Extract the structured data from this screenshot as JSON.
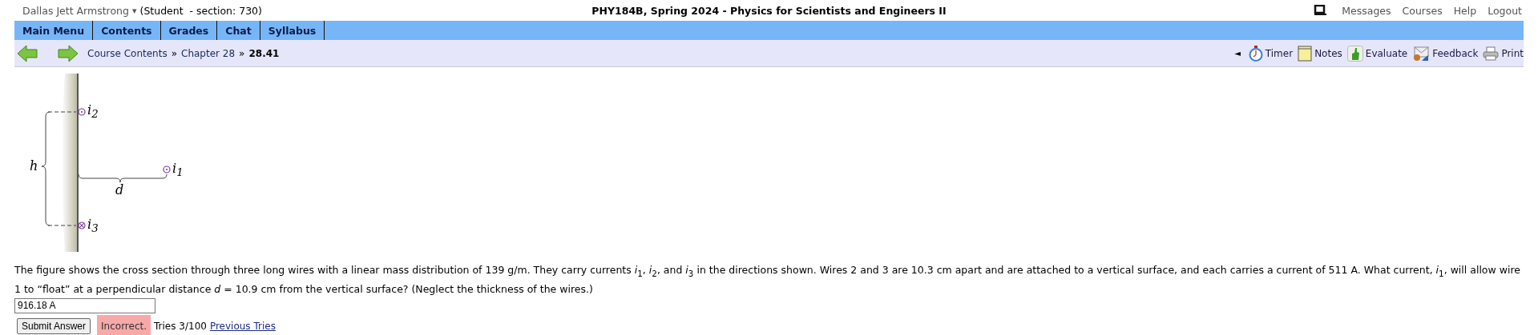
{
  "header": {
    "user_name": "Dallas Jett Armstrong",
    "user_caret": "▾",
    "role": "(Student  - section: 730)",
    "course_title": "PHY184B, Spring 2024 - Physics for Scientists and Engineers II",
    "links": [
      "Messages",
      "Courses",
      "Help",
      "Logout"
    ]
  },
  "menu": [
    "Main Menu",
    "Contents",
    "Grades",
    "Chat",
    "Syllabus"
  ],
  "breadcrumb": [
    {
      "kind": "link",
      "text": "Course Contents"
    },
    {
      "kind": "sep",
      "text": "»"
    },
    {
      "kind": "link",
      "text": "Chapter 28"
    },
    {
      "kind": "sep",
      "text": "»"
    },
    {
      "kind": "current",
      "text": "28.41"
    }
  ],
  "tools_toggle": "◄",
  "tools": [
    {
      "kind": "timer",
      "label": "Timer"
    },
    {
      "kind": "notes",
      "label": "Notes"
    },
    {
      "kind": "evaluate",
      "label": "Evaluate"
    },
    {
      "kind": "feedback",
      "label": "Feedback"
    },
    {
      "kind": "print",
      "label": "Print"
    }
  ],
  "figure": {
    "labels": [
      {
        "kind": "i2",
        "text": "i$_{2}$"
      },
      {
        "kind": "h",
        "text": "h"
      },
      {
        "kind": "i1",
        "text": "i$_{1}$"
      },
      {
        "kind": "d",
        "text": "d"
      },
      {
        "kind": "i3",
        "text": "i$_{3}$"
      }
    ]
  },
  "question": "The figure shows the cross section through three long wires with a linear mass distribution of 139 g/m. They carry currents *i*$_{1}$, *i*$_{2}$, and *i*$_{3}$ in the directions shown. Wires 2 and 3 are 10.3 cm apart and are attached to a vertical surface, and each carries a current of 511 A. What current, *i*$_{1}$, will allow wire 1 to “float” at a perpendicular distance *d* = 10.9 cm from the vertical surface? (Neglect the thickness of the wires.)",
  "answer": {
    "value": "916.18 A"
  },
  "submit": "Submit Answer",
  "result": "Incorrect.",
  "tries": "Tries 3/100",
  "previous_tries": "Previous Tries"
}
